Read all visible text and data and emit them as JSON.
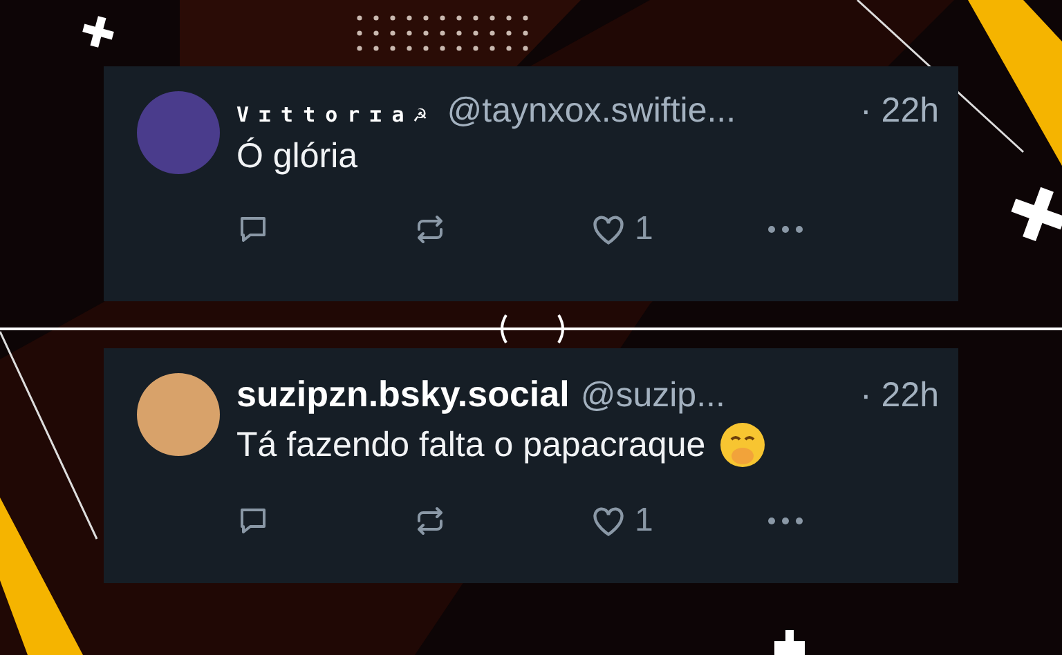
{
  "posts": [
    {
      "display_name": "Vɪttorɪa☭",
      "kind": "spaced",
      "handle": "@taynxox.swiftie...",
      "time": "· 22h",
      "text": "Ó glória",
      "emoji": false,
      "likes": "1"
    },
    {
      "display_name": "suzipzn.bsky.social",
      "kind": "bold",
      "handle": "@suzip...",
      "time": "· 22h",
      "text": "Tá fazendo falta o papacraque",
      "emoji": true,
      "likes": "1"
    }
  ]
}
